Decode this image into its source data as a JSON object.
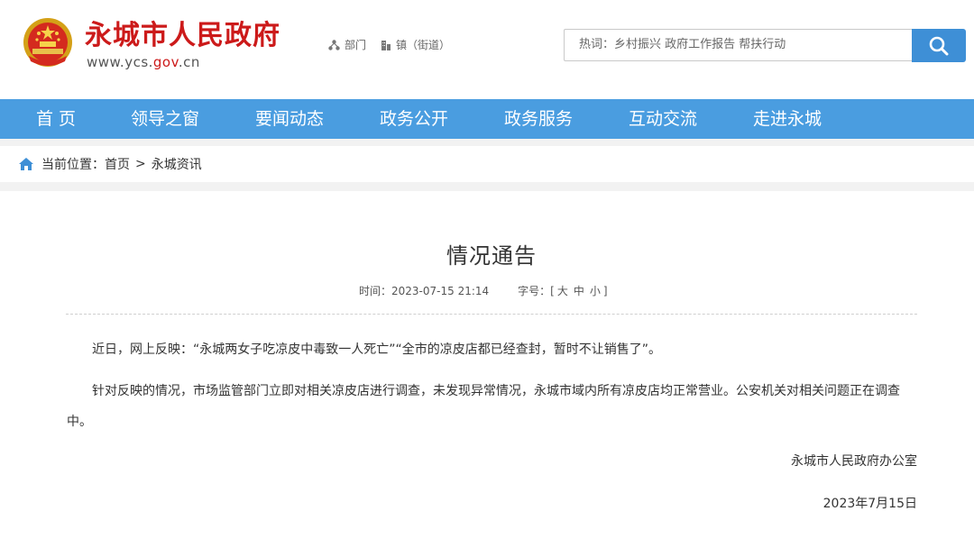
{
  "header": {
    "site_name": "永城市人民政府",
    "site_url_prefix": "www.ycs.",
    "site_url_gov": "gov",
    "site_url_suffix": ".cn",
    "quick_links": [
      "部门",
      "镇（街道）"
    ],
    "search_placeholder": "热词：乡村振兴  政府工作报告  帮扶行动",
    "icons": {
      "emblem": "national-emblem-icon",
      "search": "search-icon",
      "dept": "org-chart-icon",
      "town": "building-icon"
    }
  },
  "nav": {
    "items": [
      "首 页",
      "领导之窗",
      "要闻动态",
      "政务公开",
      "政务服务",
      "互动交流",
      "走进永城"
    ]
  },
  "breadcrumb": {
    "label": "当前位置：",
    "home": "首页",
    "separator": ">",
    "current": "永城资讯",
    "icon": "home-icon"
  },
  "article": {
    "title": "情况通告",
    "time_label": "时间：",
    "time": "2023-07-15 21:14",
    "font_label": "字号：",
    "font_open": "[",
    "font_large": "大",
    "font_medium": "中",
    "font_small": "小",
    "font_close": "]",
    "paragraphs": [
      "近日，网上反映：“永城两女子吃凉皮中毒致一人死亡”“全市的凉皮店都已经查封，暂时不让销售了”。",
      "针对反映的情况，市场监管部门立即对相关凉皮店进行调查，未发现异常情况，永城市域内所有凉皮店均正常营业。公安机关对相关问题正在调查中。"
    ],
    "signature": "永城市人民政府办公室",
    "date": "2023年7月15日"
  },
  "colors": {
    "brand_red": "#cc1a1a",
    "nav_blue": "#4a9de0",
    "search_blue": "#3e8fd6"
  }
}
